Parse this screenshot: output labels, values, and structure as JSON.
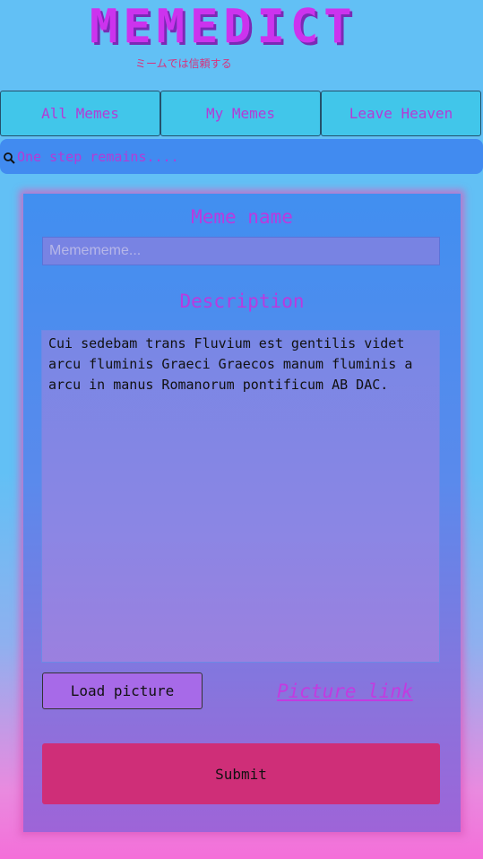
{
  "header": {
    "logo": "MEMEDICT",
    "tagline": "ミームでは信頼する"
  },
  "nav": {
    "items": [
      {
        "label": "All Memes"
      },
      {
        "label": "My Memes"
      },
      {
        "label": "Leave Heaven"
      }
    ]
  },
  "search": {
    "icon": "search-icon",
    "value": "One step remains...."
  },
  "form": {
    "name_label": "Meme name",
    "name_placeholder": "Memememe...",
    "description_label": "Description",
    "description_value": "Cui sedebam trans Fluvium est gentilis videt arcu fluminis Graeci Graecos manum fluminis a arcu in manus Romanorum pontificum AB DAC.",
    "load_picture_label": "Load picture",
    "picture_link_label": "Picture link",
    "submit_label": "Submit"
  },
  "colors": {
    "accent_text": "#b43bd6",
    "submit": "#cf2e78",
    "nav_bg": "#41c6ea"
  }
}
